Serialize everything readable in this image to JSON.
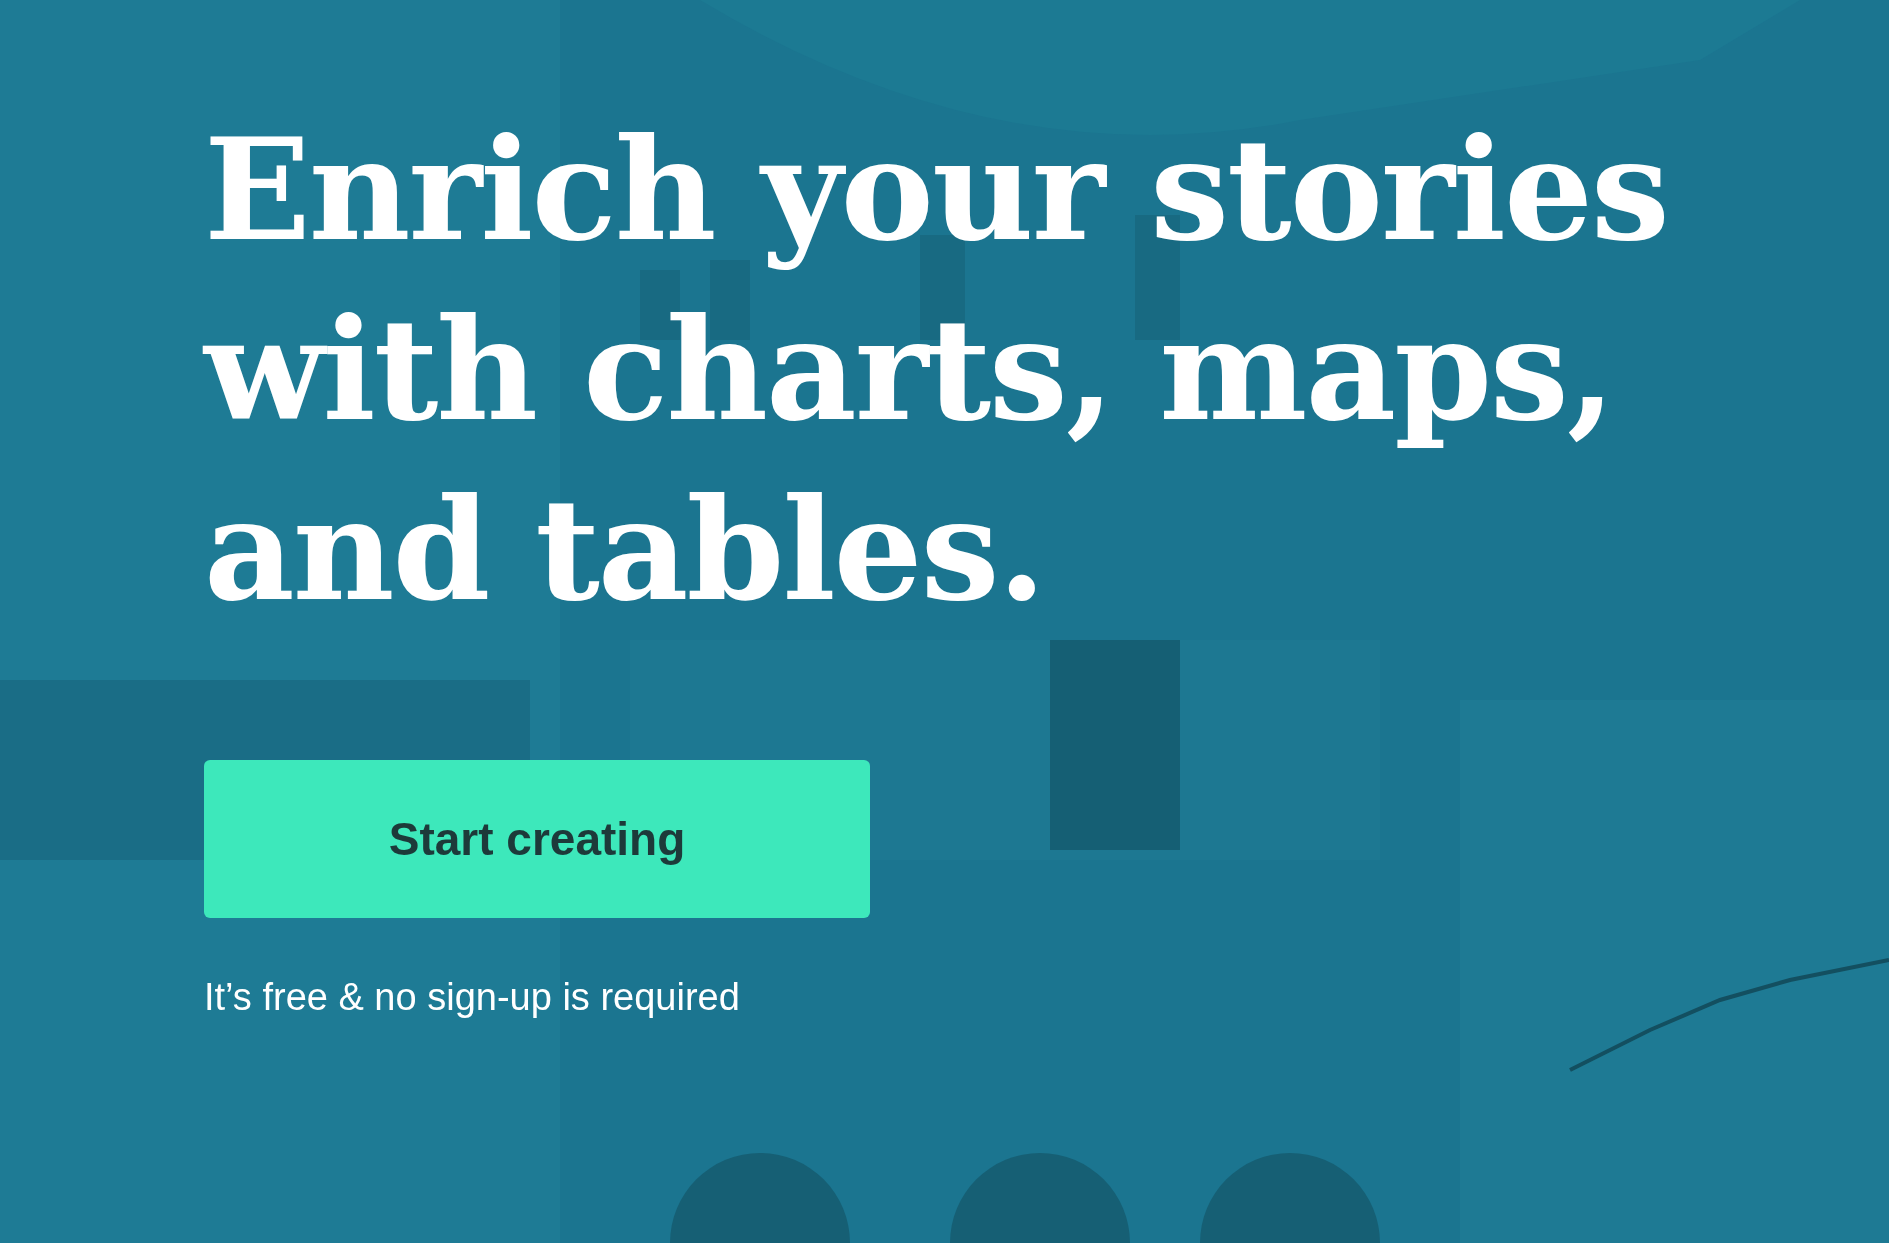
{
  "hero": {
    "headline": "Enrich your stories with charts, maps, and tables.",
    "cta_button": "Start creating",
    "note": "It’s free & no sign-up is required"
  }
}
